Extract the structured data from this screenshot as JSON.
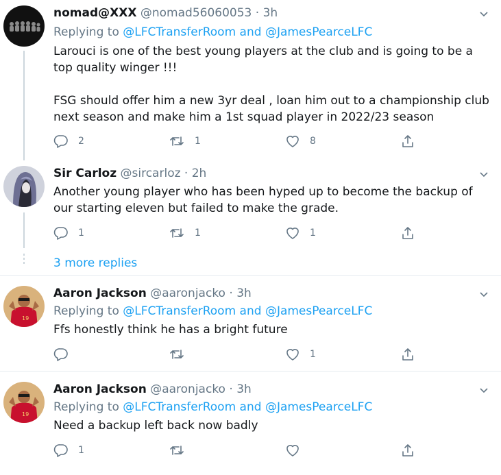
{
  "tweets": [
    {
      "name": "nomad@XXX",
      "handle": "@nomad56060053",
      "time": "3h",
      "replying_to": "Replying to",
      "mentions": [
        "@LFCTransferRoom",
        "@JamesPearceLFC"
      ],
      "mention_joiner": "and",
      "text": [
        "Larouci is one of the best young players at the club and is going to be a top quality winger !!!",
        "FSG should offer him a new 3yr deal , loan him out to a championship club next season and make him a 1st squad player in 2022/23 season"
      ],
      "replies": "2",
      "retweets": "1",
      "likes": "8"
    },
    {
      "name": "Sir Carloz",
      "handle": "@sircarloz",
      "time": "2h",
      "text": [
        "Another young player who has been hyped up to become the backup of our starting eleven but failed to make the grade."
      ],
      "replies": "1",
      "retweets": "1",
      "likes": "1"
    },
    {
      "name": "Aaron Jackson",
      "handle": "@aaronjacko",
      "time": "3h",
      "replying_to": "Replying to",
      "mentions": [
        "@LFCTransferRoom",
        "@JamesPearceLFC"
      ],
      "mention_joiner": "and",
      "text": [
        "Ffs honestly think he has a bright future"
      ],
      "replies": "",
      "retweets": "",
      "likes": "1"
    },
    {
      "name": "Aaron Jackson",
      "handle": "@aaronjacko",
      "time": "3h",
      "replying_to": "Replying to",
      "mentions": [
        "@LFCTransferRoom",
        "@JamesPearceLFC"
      ],
      "mention_joiner": "and",
      "text": [
        "Need a backup left back now badly"
      ],
      "replies": "1",
      "retweets": "",
      "likes": ""
    }
  ],
  "more_replies": "3 more replies",
  "separator": "·",
  "icons": {
    "reply": "reply-icon",
    "retweet": "retweet-icon",
    "like": "heart-icon",
    "share": "share-icon",
    "caret": "chevron-down-icon"
  },
  "colors": {
    "link": "#1da1f2",
    "secondary_text": "#657786",
    "primary_text": "#14171a",
    "divider": "#e6ecf0",
    "thread_line": "#ccd6dd"
  }
}
